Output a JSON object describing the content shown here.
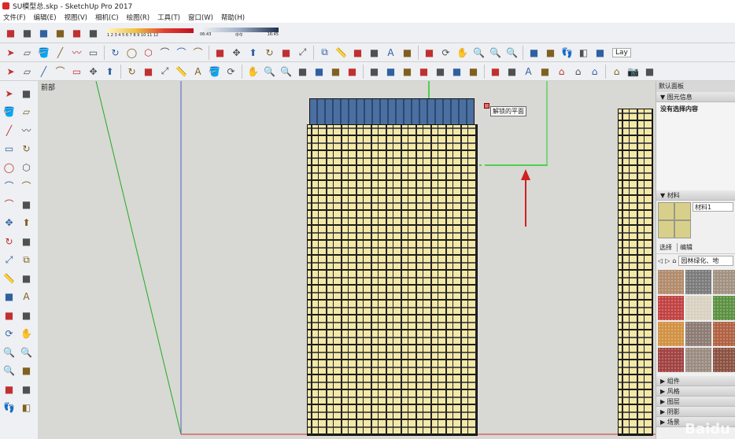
{
  "window": {
    "title": "SU模型总.skp - SketchUp Pro 2017"
  },
  "menu": [
    "文件(F)",
    "编辑(E)",
    "视图(V)",
    "相机(C)",
    "绘图(R)",
    "工具(T)",
    "窗口(W)",
    "帮助(H)"
  ],
  "toolbar1": {
    "icons": [
      "warehouse-icon",
      "share-model-icon",
      "upload-icon",
      "link-icon",
      "extension-icon",
      "shadow-icon"
    ],
    "shadow_months": "1 2 3 4 5 6 7 8 9 10 11 12",
    "shadow_times": [
      "06:43",
      "中午",
      "16:45"
    ]
  },
  "toolbar2": [
    "select-icon",
    "eraser-icon",
    "paint-icon",
    "line-icon",
    "freehand-icon",
    "rectangle-icon",
    "rotated-rect-icon",
    "circle-icon",
    "polygon-icon",
    "arc-icon",
    "arc2-icon",
    "arc3-icon",
    "pie-icon",
    "move-icon",
    "pushpull-icon",
    "rotate-icon",
    "followme-icon",
    "scale-icon",
    "offset-icon",
    "tape-icon",
    "dimension-icon",
    "protractor-icon",
    "text-icon",
    "axes-icon",
    "3dtext-icon",
    "orbit-icon",
    "pan-icon",
    "zoom-icon",
    "zoom-window-icon",
    "zoom-extents-icon",
    "position-camera-icon",
    "lookaround-icon",
    "walk-icon",
    "section-icon",
    "layers-icon"
  ],
  "toolbar2_extra": "Lay",
  "toolbar3": [
    "select-icon",
    "eraser-icon",
    "line-icon",
    "arc-icon",
    "rectangle-icon",
    "move-icon",
    "pushpull-icon",
    "rotate-icon",
    "followme-icon",
    "scale-icon",
    "tape-icon",
    "text-icon",
    "paint-icon",
    "orbit-icon",
    "pan-icon",
    "zoom-icon",
    "zoom-extents-icon",
    "warehouse-icon",
    "extension-icon",
    "share-icon",
    "iso-view-icon",
    "top-view-icon",
    "front-view-icon",
    "right-view-icon",
    "back-view-icon",
    "left-view-icon",
    "xray-icon",
    "wireframe-icon",
    "hidden-line-icon",
    "shaded-icon",
    "textured-icon",
    "monochrome-icon",
    "house-icon",
    "house2-icon",
    "house3-icon",
    "house4-icon",
    "camera-icon",
    "layer-icon"
  ],
  "leftbar": [
    "select-icon",
    "component-icon",
    "paint-icon",
    "eraser-icon",
    "line-icon",
    "freehand-icon",
    "rectangle-icon",
    "rotated-rect-icon",
    "circle-icon",
    "polygon-icon",
    "arc-icon",
    "arc2-icon",
    "arc3-icon",
    "pie-icon",
    "move-icon",
    "pushpull-icon",
    "rotate-icon",
    "followme-icon",
    "scale-icon",
    "offset-icon",
    "tape-icon",
    "dimension-icon",
    "protractor-icon",
    "text-icon",
    "axes-icon",
    "3dtext-icon",
    "orbit-icon",
    "pan-icon",
    "zoom-icon",
    "zoom-window-icon",
    "zoom-extents-icon",
    "previous-icon",
    "position-camera-icon",
    "lookaround-icon",
    "walk-icon",
    "section-icon"
  ],
  "viewport": {
    "view_label": "前部",
    "tooltip": "解锁的平面"
  },
  "panel": {
    "title": "默认面板",
    "entity_info": "图元信息",
    "no_selection": "没有选择内容",
    "materials": "材料",
    "material_name": "材料1",
    "tab_select": "选择",
    "tab_edit": "编辑",
    "library": "园林绿化、地",
    "sections": [
      "组件",
      "风格",
      "图层",
      "阴影",
      "场景"
    ]
  },
  "watermark": "Bai du 经验",
  "colors": {
    "swatches": [
      "#b08a6a",
      "#7a7a7a",
      "#a09080",
      "#c04040",
      "#d8d0c0",
      "#5a9040",
      "#d09040",
      "#8a7a70",
      "#b06040",
      "#a04040",
      "#9a8a80",
      "#8a5040"
    ]
  }
}
